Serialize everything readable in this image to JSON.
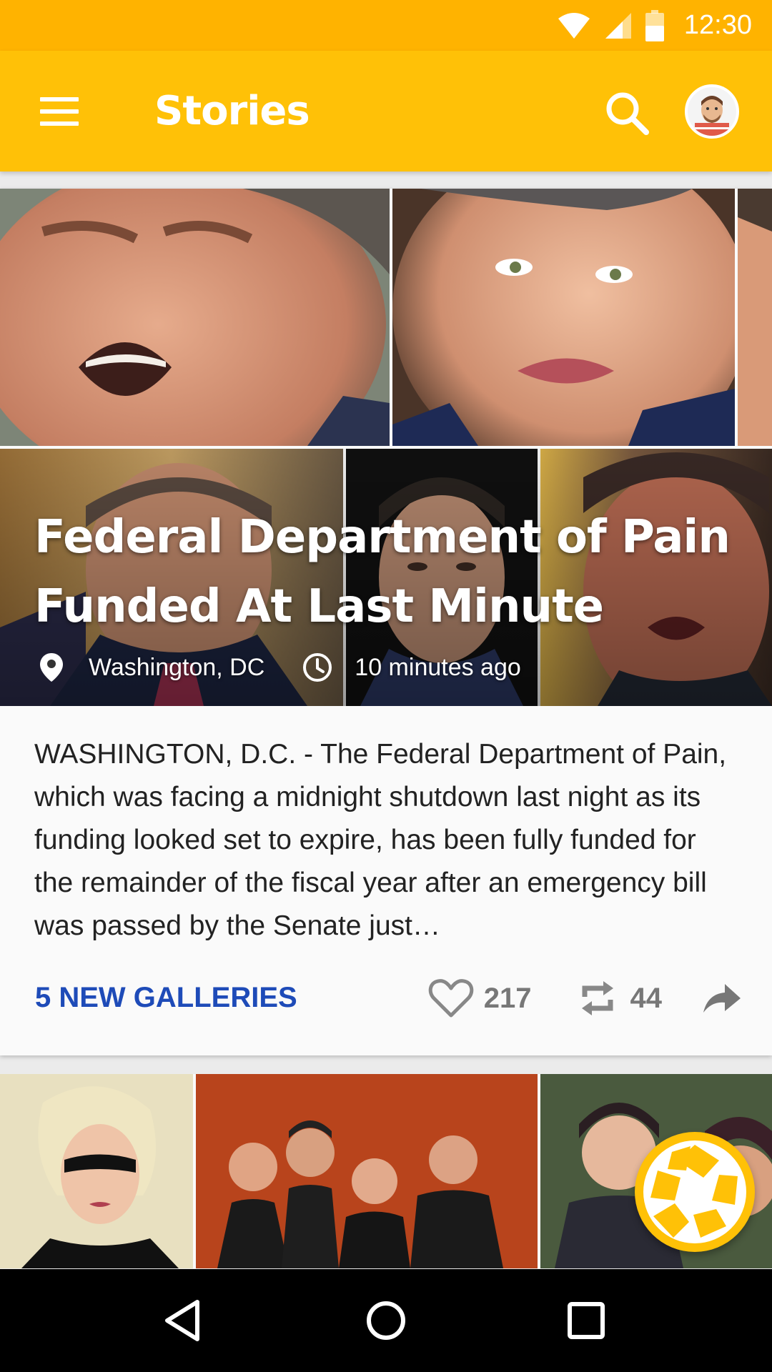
{
  "status_bar": {
    "time": "12:30",
    "icons": [
      "wifi-icon",
      "signal-icon",
      "battery-icon"
    ],
    "color": "#ffb300"
  },
  "app_bar": {
    "title": "Stories",
    "color": "#ffc107",
    "icons": [
      "menu-icon",
      "search-icon",
      "avatar"
    ]
  },
  "story": {
    "title": "Federal Department of Pain Funded At Last Minute",
    "location": "Washington, DC",
    "time_ago": "10 minutes ago",
    "body": "WASHINGTON, D.C. - The Federal Department of Pain, which was facing a midnight shutdown last night as its funding looked set to expire, has been fully funded for the remainder of the fiscal year after an emergency bill was passed by the Senate just…",
    "galleries_link": "5 NEW GALLERIES",
    "likes": "217",
    "reposts": "44",
    "link_color": "#1e4bb8"
  },
  "fab": {
    "icon": "camera-shutter-icon",
    "color": "#ffc107"
  },
  "nav_bar": {
    "icons": [
      "back-icon",
      "home-icon",
      "recents-icon"
    ]
  }
}
